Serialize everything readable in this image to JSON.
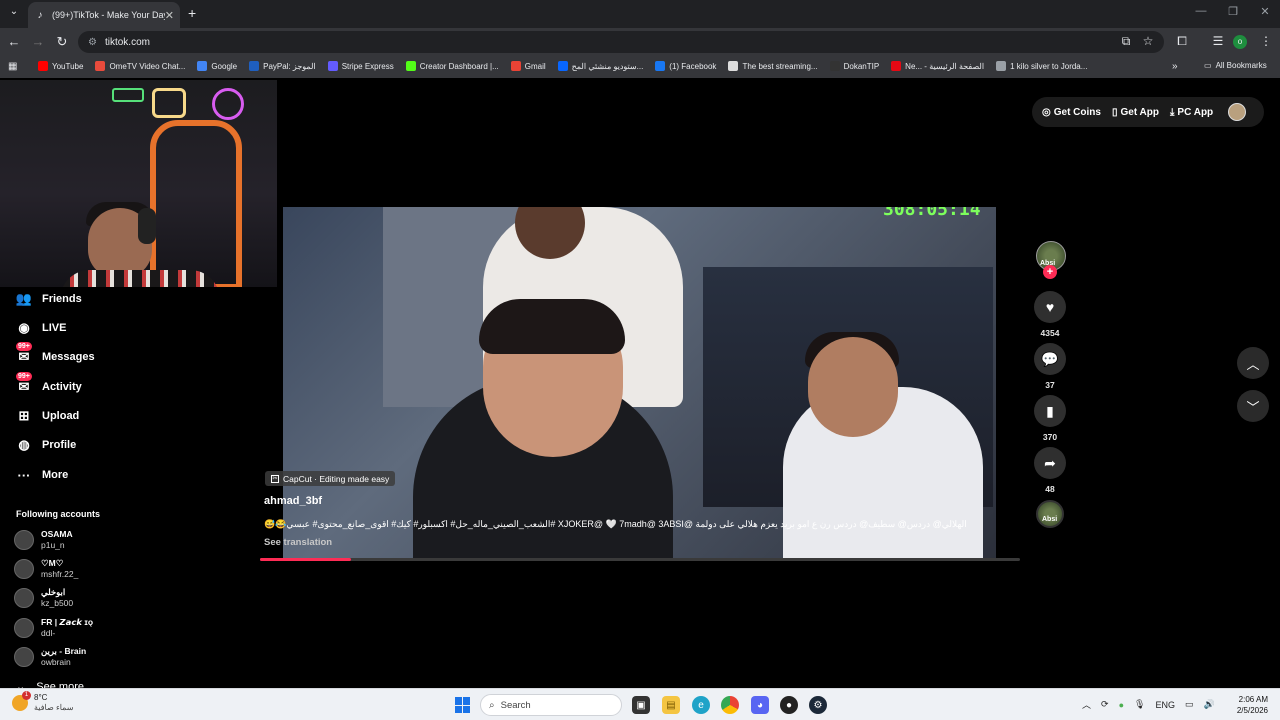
{
  "browser": {
    "tab_title": "(99+)TikTok - Make Your Day",
    "tab_favicon": "tiktok-icon",
    "url": "tiktok.com",
    "bookmarks": [
      {
        "label": "YouTube",
        "color": "#ff0000"
      },
      {
        "label": "OmeTV Video Chat...",
        "color": "#e94b3c"
      },
      {
        "label": "Google",
        "color": "#4285f4"
      },
      {
        "label": "PayPal: الموجز",
        "color": "#1f5fbf"
      },
      {
        "label": "Stripe Express",
        "color": "#635bff"
      },
      {
        "label": "Creator Dashboard |...",
        "color": "#53fc18"
      },
      {
        "label": "Gmail",
        "color": "#ea4335"
      },
      {
        "label": "ستوديو منشئي المح...",
        "color": "#0866ff"
      },
      {
        "label": "(1) Facebook",
        "color": "#1877f2"
      },
      {
        "label": "The best streaming...",
        "color": "#dddddd"
      },
      {
        "label": "DokanTIP",
        "color": "#333333"
      },
      {
        "label": "Ne... - الصفحة الرئيسية",
        "color": "#e50914"
      },
      {
        "label": "1 kilo silver to Jorda...",
        "color": "#9aa0a6"
      }
    ],
    "all_bookmarks": "All Bookmarks",
    "profile_initial": "o"
  },
  "sidebar": {
    "items": [
      {
        "label": "Friends",
        "icon": "friends-icon"
      },
      {
        "label": "LIVE",
        "icon": "live-icon"
      },
      {
        "label": "Messages",
        "icon": "messages-icon",
        "badge": "99+"
      },
      {
        "label": "Activity",
        "icon": "activity-icon",
        "badge": "99+"
      },
      {
        "label": "Upload",
        "icon": "upload-icon"
      },
      {
        "label": "Profile",
        "icon": "profile-icon"
      },
      {
        "label": "More",
        "icon": "more-icon"
      }
    ],
    "following_title": "Following accounts",
    "accounts": [
      {
        "name": "OSAMA",
        "username": "p1u_n"
      },
      {
        "name": "♡M♡",
        "username": "mshfr.22_"
      },
      {
        "name": "ابوخلي",
        "username": "kz_b500"
      },
      {
        "name": "FR | 𝙕𝙖𝙘𝙠 ɪǫ",
        "username": "ddl-"
      },
      {
        "name": "برين - Brain",
        "username": "owbrain"
      }
    ],
    "see_more": "See more"
  },
  "topbar": {
    "get_coins": "Get Coins",
    "get_app": "Get App",
    "pc_app": "PC App"
  },
  "video": {
    "timer_overlay": "308:05:14",
    "capcut_label": "CapCut · Editing made easy",
    "author": "ahmad_3bf",
    "caption": "😅😂الشعب_الصيني_ماله_حل# اكسبلور# كيك# اقوى_صانع_محتوى# عبسي# XJOKER@ 🤍 7madh@ 3ABSI@ الهلالي@ دردس@ سطيف@ دردس رن ع امو بريد يعزم هلالي على دولمة",
    "see_translation": "See translation",
    "progress": 0.12
  },
  "actions": {
    "creator_label": "Absi",
    "likes": "4354",
    "comments": "37",
    "saves": "370",
    "shares": "48"
  },
  "taskbar": {
    "weather_temp": "8°C",
    "weather_desc": "سماء صافية",
    "weather_badge": "1",
    "search_placeholder": "Search",
    "language": "ENG",
    "time": "2:06 AM",
    "date": "2/5/2026"
  }
}
